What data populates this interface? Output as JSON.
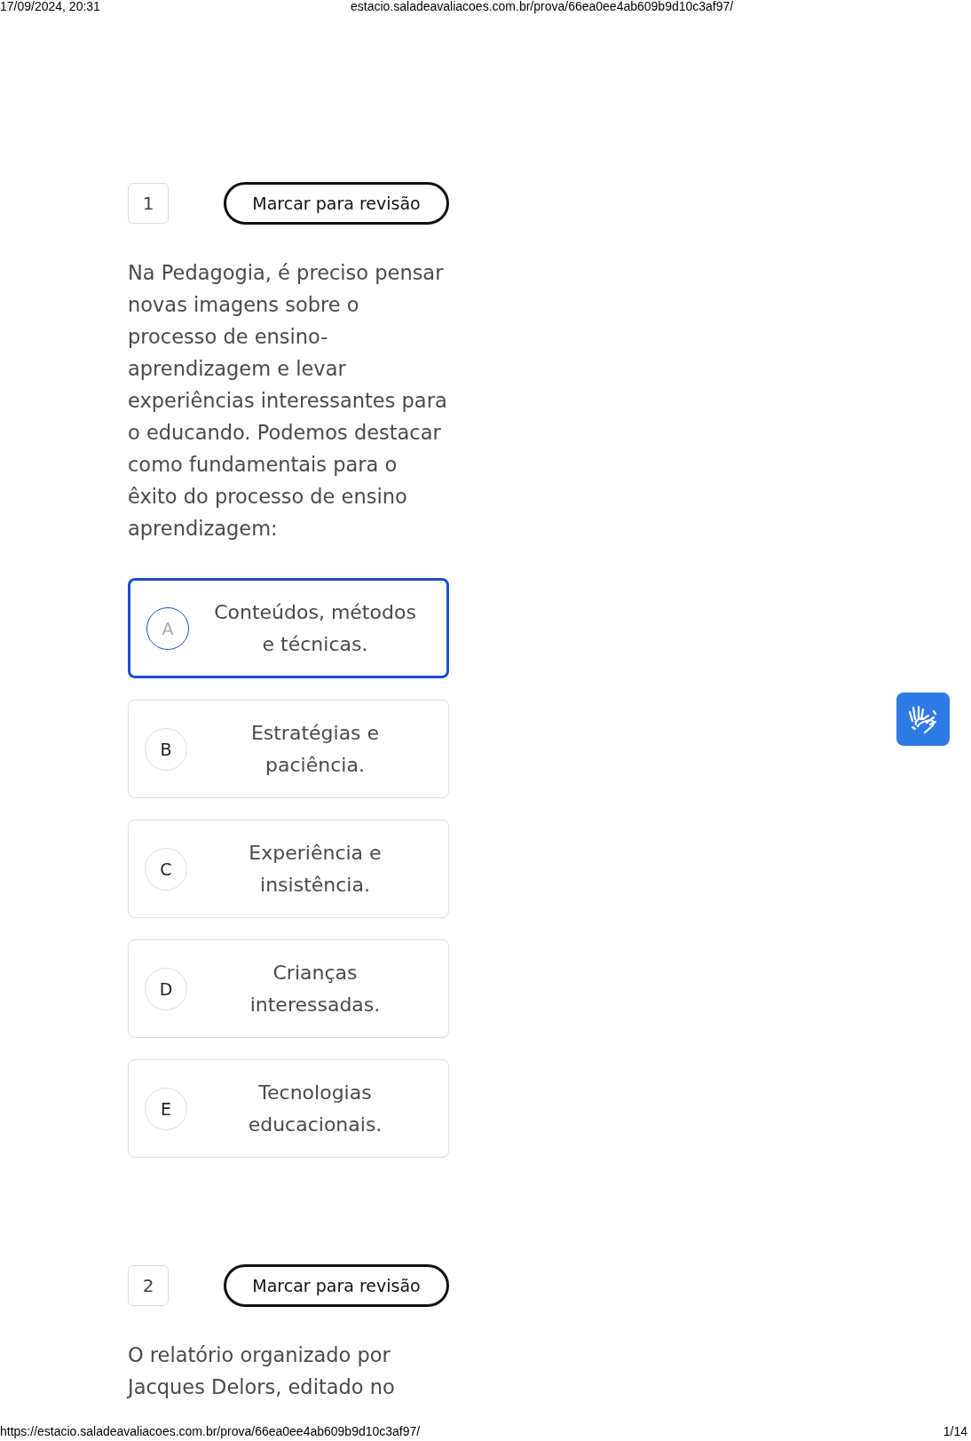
{
  "print_header": {
    "date": "17/09/2024, 20:31",
    "url": "estacio.saladeavaliacoes.com.br/prova/66ea0ee4ab609b9d10c3af97/"
  },
  "questions": [
    {
      "number": "1",
      "review_button": "Marcar para revisão",
      "text": "Na Pedagogia, é preciso pensar novas imagens sobre o processo de ensino-aprendizagem e levar experiências interessantes para o educando. Podemos destacar como fundamentais para o êxito do processo de ensino aprendizagem:",
      "options": [
        {
          "letter": "A",
          "text": "Conteúdos, métodos e técnicas.",
          "selected": true
        },
        {
          "letter": "B",
          "text": "Estratégias e paciência.",
          "selected": false
        },
        {
          "letter": "C",
          "text": "Experiência e insistência.",
          "selected": false
        },
        {
          "letter": "D",
          "text": "Crianças interessadas.",
          "selected": false
        },
        {
          "letter": "E",
          "text": "Tecnologias educacionais.",
          "selected": false
        }
      ]
    },
    {
      "number": "2",
      "review_button": "Marcar para revisão",
      "text": "O relatório organizado por Jacques Delors, editado no"
    }
  ],
  "print_footer": {
    "url": "https://estacio.saladeavaliacoes.com.br/prova/66ea0ee4ab609b9d10c3af97/",
    "page": "1/14"
  }
}
